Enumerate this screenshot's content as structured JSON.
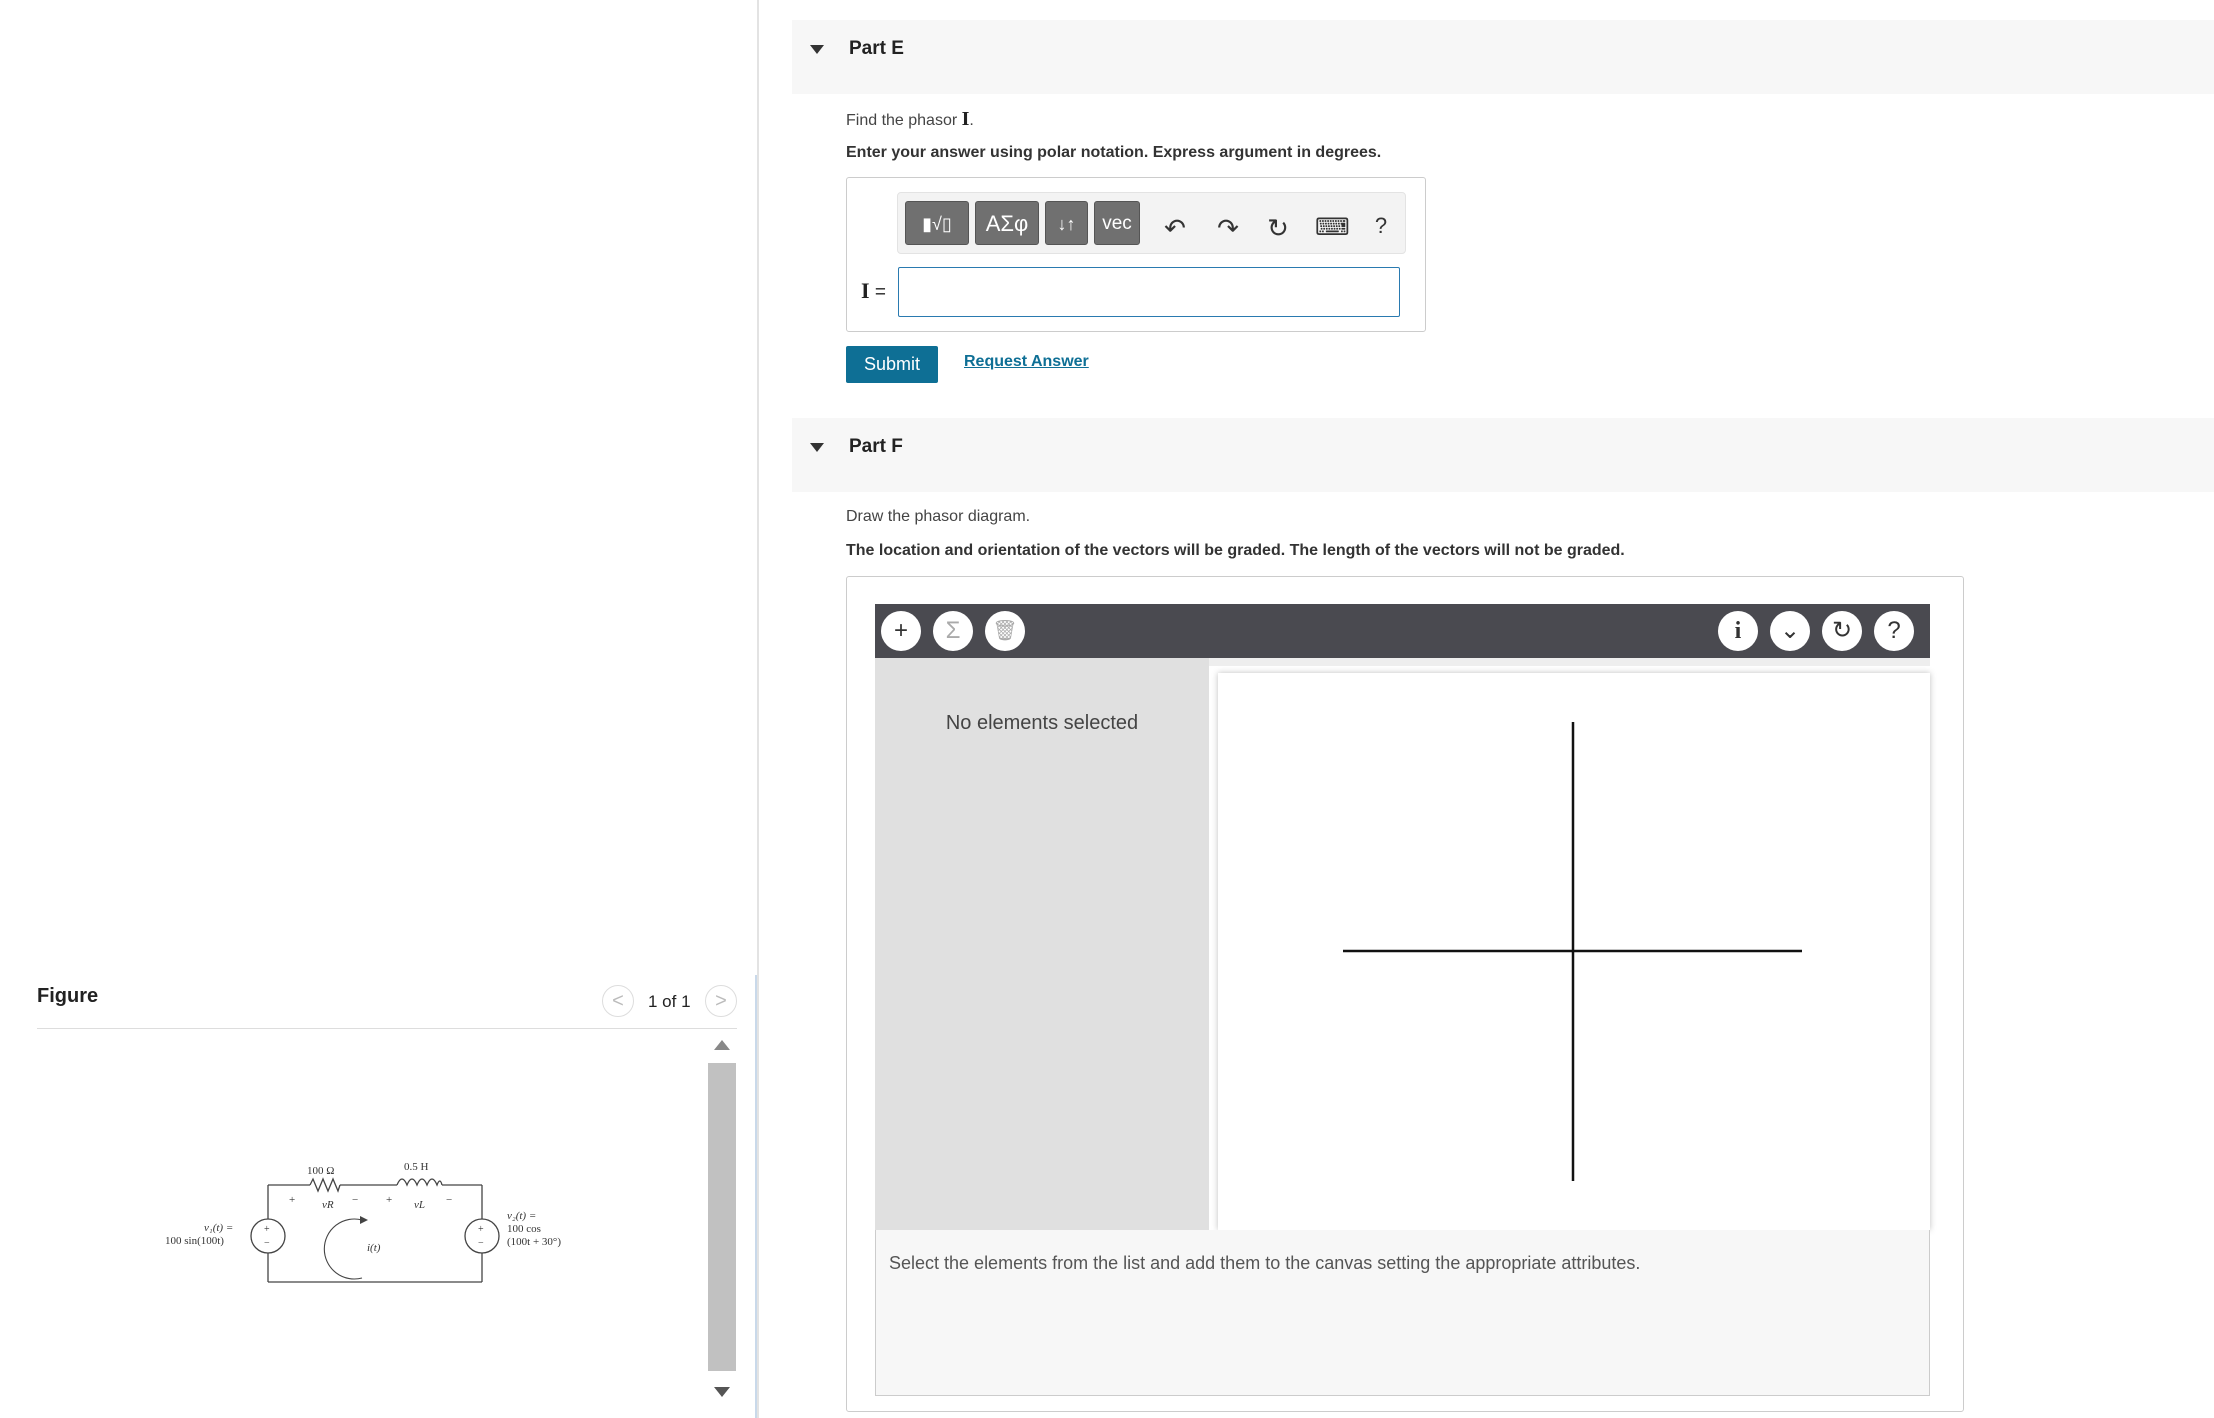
{
  "figure": {
    "title": "Figure",
    "counter": "1 of 1",
    "prev_glyph": "<",
    "next_glyph": ">",
    "circuit_labels": {
      "resistor": "100 Ω",
      "inductor": "0.5 H",
      "vR": "vR",
      "vL": "vL",
      "current": "i(t)",
      "plus": "+",
      "minus": "−",
      "source1_line1": "v₁(t) =",
      "source1_line2": "100 sin(100t)",
      "source2_line1": "v₂(t) =",
      "source2_line2": "100 cos",
      "source2_line3": "(100t + 30°)"
    }
  },
  "part_e": {
    "title": "Part E",
    "prompt": "Find the phasor ",
    "prompt_symbol": "I",
    "prompt_end": ".",
    "instruction": "Enter your answer using polar notation. Express argument in degrees.",
    "toolbar": {
      "template_label": "▮√▯",
      "greek_label": "ΑΣφ",
      "updown_label": "↓↑",
      "vec_label": "vec",
      "undo_icon": "↶",
      "redo_icon": "↷",
      "reset_icon": "↻",
      "keyboard_icon": "⌨",
      "help_icon": "?"
    },
    "answer_symbol": "I",
    "answer_equals": " =",
    "answer_value": "",
    "submit_label": "Submit",
    "request_label": "Request Answer"
  },
  "part_f": {
    "title": "Part F",
    "prompt": "Draw the phasor diagram.",
    "instruction": "The location and orientation of the vectors will be graded. The length of the vectors will not be graded.",
    "tool": {
      "add_icon": "+",
      "sum_icon": "Σ",
      "trash_icon": "🗑",
      "info_icon": "i",
      "dropdown_icon": "⌄",
      "reset_icon": "↻",
      "help_icon": "?",
      "side_text": "No elements selected",
      "bottom_text": "Select the elements from the list and add them to the canvas setting the appropriate attributes."
    }
  },
  "colors": {
    "accent": "#0e6f95",
    "toolbar_dark": "#4a4a50",
    "panel_gray": "#e0e0e0"
  }
}
